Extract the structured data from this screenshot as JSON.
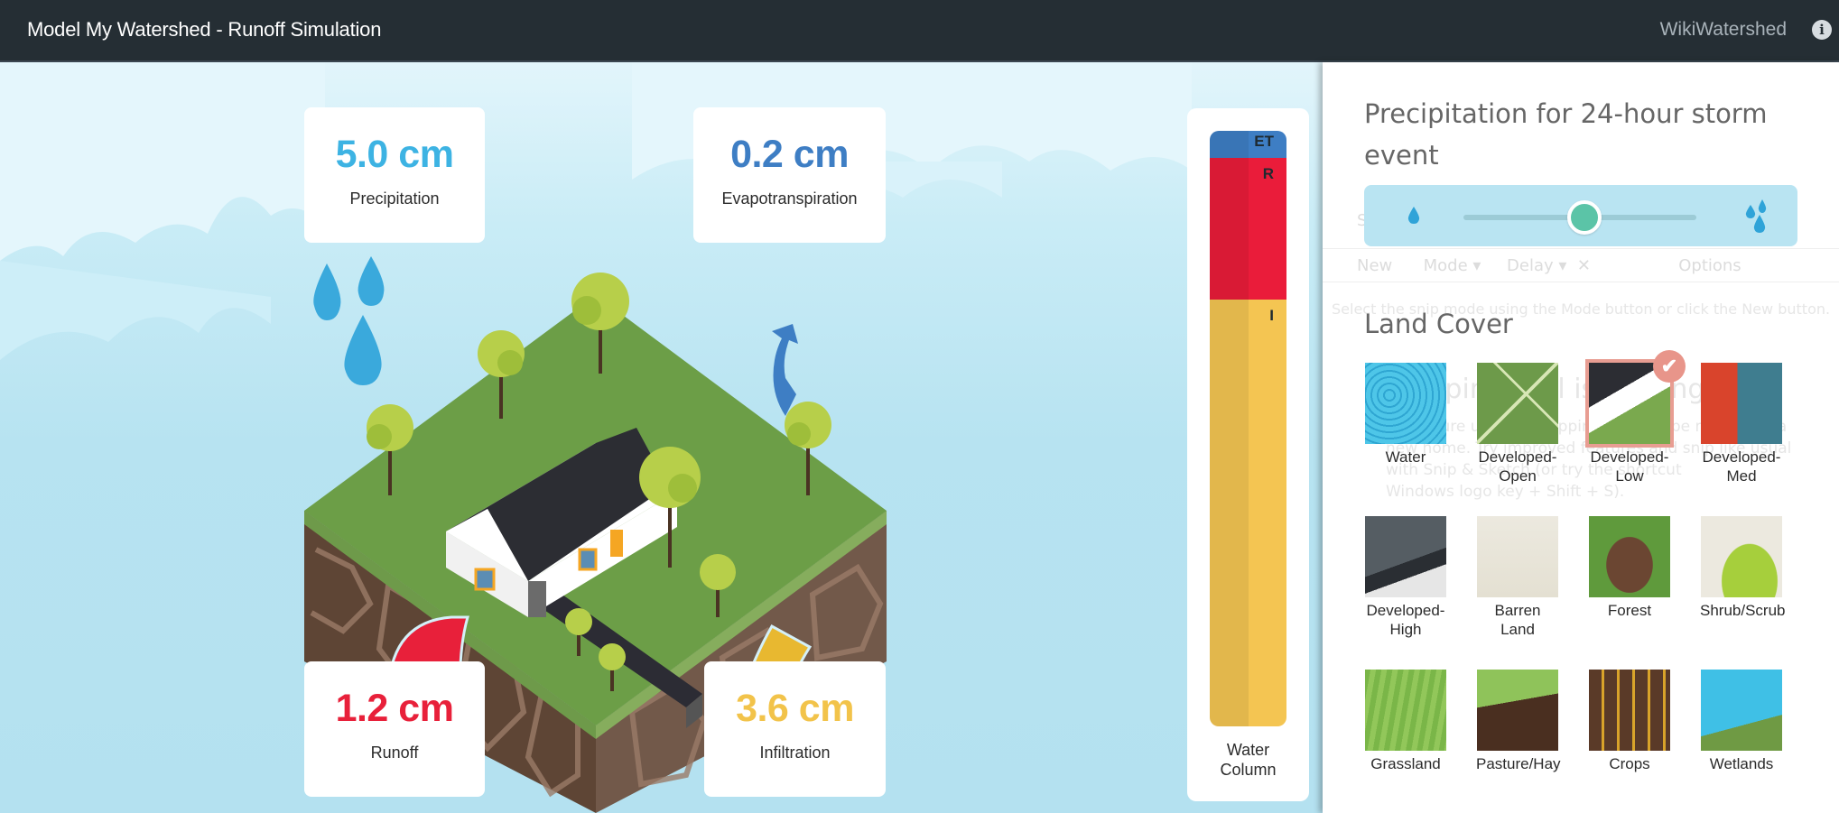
{
  "header": {
    "title": "Model My Watershed - Runoff Simulation",
    "link": "WikiWatershed",
    "info_icon": "info-icon"
  },
  "results": {
    "precipitation": {
      "value": "5.0 cm",
      "label": "Precipitation",
      "color": "#3db3e3"
    },
    "evapotranspiration": {
      "value": "0.2 cm",
      "label": "Evapotranspiration",
      "color": "#3e7ec4"
    },
    "runoff": {
      "value": "1.2 cm",
      "label": "Runoff",
      "color": "#e8203a"
    },
    "infiltration": {
      "value": "3.6 cm",
      "label": "Infiltration",
      "color": "#f2c34a"
    }
  },
  "water_column": {
    "label_line1": "Water",
    "label_line2": "Column",
    "segments": [
      {
        "key": "ET",
        "label": "ET",
        "value_cm": 0.2,
        "color": "#3e7ec4"
      },
      {
        "key": "R",
        "label": "R",
        "value_cm": 1.2,
        "color": "#ea1c3a"
      },
      {
        "key": "I",
        "label": "I",
        "value_cm": 3.6,
        "color": "#f4c552"
      }
    ]
  },
  "panel": {
    "precip_title": "Precipitation for 24-hour storm event",
    "slider": {
      "value_cm": 5.0,
      "fraction": 0.52,
      "min_icon": "single-drop-icon",
      "max_icon": "multi-drop-icon"
    },
    "land_cover_title": "Land Cover",
    "land_cover": [
      {
        "name": "Water",
        "selected": false
      },
      {
        "name": "Developed-Open",
        "selected": false
      },
      {
        "name": "Developed-Low",
        "selected": true
      },
      {
        "name": "Developed-Med",
        "selected": false
      },
      {
        "name": "Developed-High",
        "selected": false
      },
      {
        "name": "Barren Land",
        "selected": false
      },
      {
        "name": "Forest",
        "selected": false
      },
      {
        "name": "Shrub/Scrub",
        "selected": false
      },
      {
        "name": "Grassland",
        "selected": false
      },
      {
        "name": "Pasture/Hay",
        "selected": false
      },
      {
        "name": "Crops",
        "selected": false
      },
      {
        "name": "Wetlands",
        "selected": false
      }
    ],
    "land_cover_lines": [
      [
        "Water",
        ""
      ],
      [
        "Developed-",
        "Open"
      ],
      [
        "Developed-",
        "Low"
      ],
      [
        "Developed-",
        "Med"
      ],
      [
        "Developed-",
        "High"
      ],
      [
        "Barren Land",
        ""
      ],
      [
        "Forest",
        ""
      ],
      [
        "Shrub/Scrub",
        ""
      ],
      [
        "Grassland",
        ""
      ],
      [
        "Pasture/Hay",
        ""
      ],
      [
        "Crops",
        ""
      ],
      [
        "Wetlands",
        ""
      ]
    ],
    "check_glyph": "✔"
  },
  "ghost_overlay": {
    "title": "Snipping Tool",
    "toolbar": [
      "New",
      "Mode",
      "Delay",
      "Cancel",
      "Options"
    ],
    "hint": "Select the snip mode using the Mode button or click the New button.",
    "notice_title": "Snipping Tool is moving",
    "notice_body": [
      "In a future update, Snipping Tool will be moving to a",
      "new home. Try improved features and snip like usual",
      "with Snip & Sketch (or try the shortcut",
      "Windows logo key + Shift + S)."
    ]
  }
}
